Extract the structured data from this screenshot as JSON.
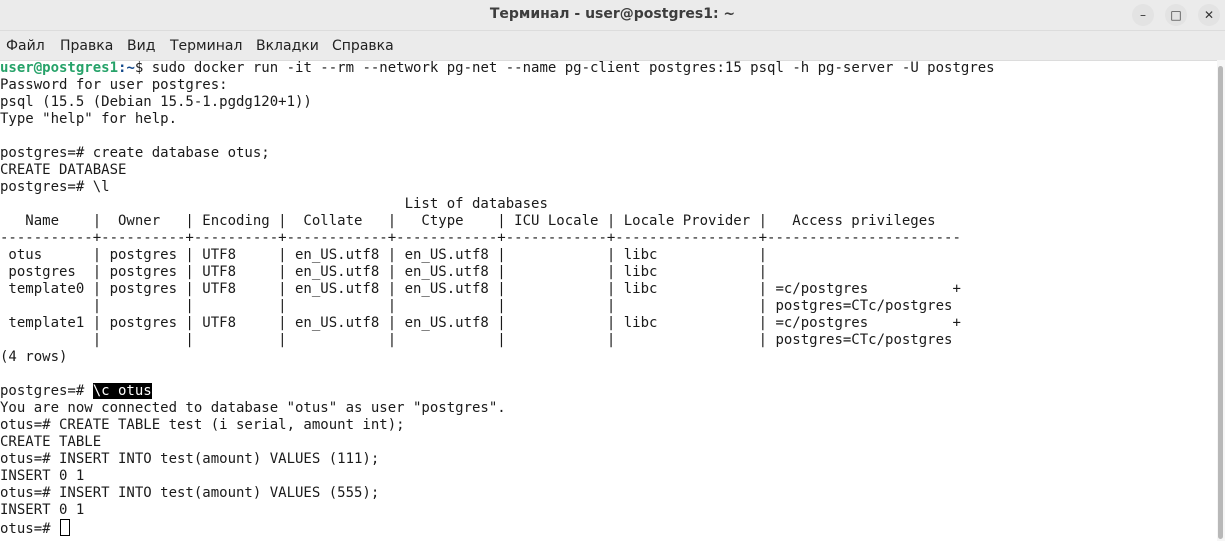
{
  "window": {
    "title": "Терминал - user@postgres1: ~",
    "buttons": {
      "minimize": "–",
      "maximize": "□",
      "close": "✕"
    }
  },
  "menu": [
    "Файл",
    "Правка",
    "Вид",
    "Терминал",
    "Вкладки",
    "Справка"
  ],
  "terminal": {
    "prompt_user": "user@postgres1",
    "prompt_path": ":~",
    "command": "$ sudo docker run -it --rm --network pg-net --name pg-client postgres:15 psql -h pg-server -U postgres",
    "lines": [
      "Password for user postgres:",
      "psql (15.5 (Debian 15.5-1.pgdg120+1))",
      "Type \"help\" for help.",
      "",
      "postgres=# create database otus;",
      "CREATE DATABASE",
      "postgres=# \\l",
      "                                                List of databases",
      "   Name    |  Owner   | Encoding |  Collate   |   Ctype    | ICU Locale | Locale Provider |   Access privileges",
      "-----------+----------+----------+------------+------------+------------+-----------------+-----------------------",
      " otus      | postgres | UTF8     | en_US.utf8 | en_US.utf8 |            | libc            |",
      " postgres  | postgres | UTF8     | en_US.utf8 | en_US.utf8 |            | libc            |",
      " template0 | postgres | UTF8     | en_US.utf8 | en_US.utf8 |            | libc            | =c/postgres          +",
      "           |          |          |            |            |            |                 | postgres=CTc/postgres",
      " template1 | postgres | UTF8     | en_US.utf8 | en_US.utf8 |            | libc            | =c/postgres          +",
      "           |          |          |            |            |            |                 | postgres=CTc/postgres",
      "(4 rows)",
      ""
    ],
    "connect_prompt": "postgres=# ",
    "connect_cmd": "\\c otus",
    "lines_after": [
      "You are now connected to database \"otus\" as user \"postgres\".",
      "otus=# CREATE TABLE test (i serial, amount int);",
      "CREATE TABLE",
      "otus=# INSERT INTO test(amount) VALUES (111);",
      "INSERT 0 1",
      "otus=# INSERT INTO test(amount) VALUES (555);",
      "INSERT 0 1"
    ],
    "final_prompt": "otus=# "
  }
}
